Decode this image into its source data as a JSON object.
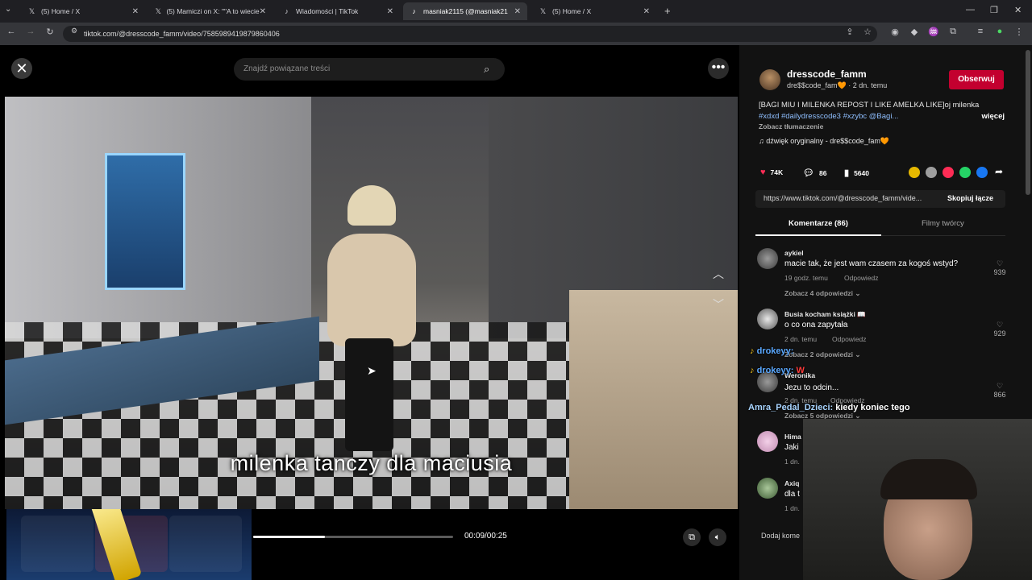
{
  "browser": {
    "tabs": [
      {
        "title": "(5) Home / X",
        "icon": "x-logo-icon"
      },
      {
        "title": "(5) Mamiczi on X: \"\"A to wiecie",
        "icon": "x-logo-icon"
      },
      {
        "title": "Wiadomości | TikTok",
        "icon": "tiktok-icon"
      },
      {
        "title": "masniak2115 (@masniak21",
        "icon": "tiktok-icon"
      },
      {
        "title": "(5) Home / X",
        "icon": "x-logo-icon"
      }
    ],
    "url": "tiktok.com/@dresscode_famm/video/7585989419879860406"
  },
  "player": {
    "search_placeholder": "Znajdź powiązane treści",
    "caption": "milenka tanczy dla maciusia",
    "time": "00:09/00:25",
    "progress": 0.36
  },
  "post": {
    "author": "dresscode_famm",
    "author_sub": "dre$$code_fam🧡 · 2 dn. temu",
    "follow_label": "Obserwuj",
    "description": "[BAGI MIU I MILENKA REPOST I LIKE AMELKA LIKE]oj milenka",
    "tags": "#xdxd #dailydresscode3 #xzybc @Bagi...",
    "more_label": "więcej",
    "translate_label": "Zobacz tłumaczenie",
    "sound": "♫  dźwięk oryginalny - dre$$code_fam🧡",
    "likes": "74K",
    "comments": "86",
    "saves": "5640",
    "link": "https://www.tiktok.com/@dresscode_famm/vide...",
    "copy_link_label": "Skopiuj łącze",
    "share_colors": [
      "#e6b800",
      "#9e9e9e",
      "#fe2c55",
      "#25d366",
      "#1877f2"
    ]
  },
  "tabs": {
    "comments": "Komentarze (86)",
    "creator": "Filmy twórcy"
  },
  "comments": [
    {
      "user": "aykiel",
      "text": "macie tak, że jest wam czasem za kogoś wstyd?",
      "time": "19 godz. temu",
      "reply": "Odpowiedz",
      "likes": "939",
      "replies": "Zobacz 4 odpowiedzi ⌄"
    },
    {
      "user": "Busia kocham książki 📖",
      "text": "o co ona zapytała",
      "time": "2 dn. temu",
      "reply": "Odpowiedz",
      "likes": "929",
      "replies": "Zobacz 2 odpowiedzi ⌄"
    },
    {
      "user": "Weronika",
      "text": "Jezu to odcin...",
      "time": "2 dn. temu",
      "reply": "Odpowiedz",
      "likes": "866",
      "replies": "Zobacz 5 odpowiedzi ⌄"
    },
    {
      "user": "Hima",
      "text": "Jaki",
      "time": "1 dn."
    },
    {
      "user": "Axiq",
      "text": "dla t",
      "time": "1 dn."
    }
  ],
  "add_comment": "Dodaj kome",
  "stream_chat": [
    {
      "user": "drokeyy:",
      "text": ""
    },
    {
      "user": "drokeyy:",
      "text": "W"
    },
    {
      "user": "Amra_Pedal_Dzieci:",
      "text": "kiedy koniec tego"
    }
  ]
}
